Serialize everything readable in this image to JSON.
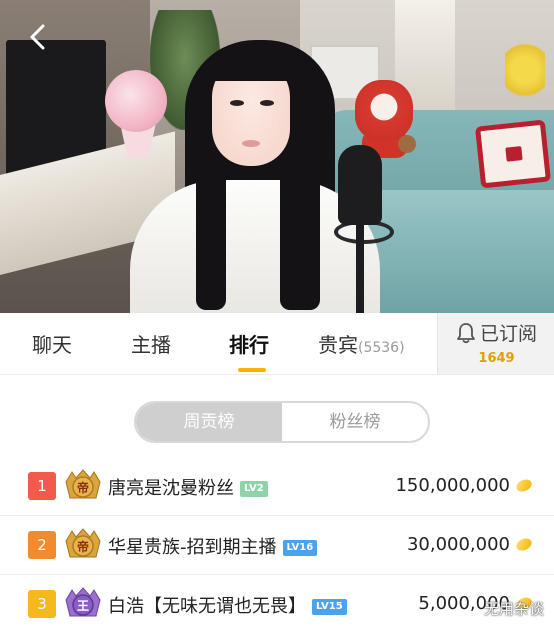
{
  "tabs": [
    {
      "label": "聊天",
      "active": false
    },
    {
      "label": "主播",
      "active": false
    },
    {
      "label": "排行",
      "active": true
    },
    {
      "label": "贵宾",
      "count": "(5536)",
      "active": false
    }
  ],
  "subscribe": {
    "label": "已订阅",
    "count": "1649",
    "icon": "bell-icon"
  },
  "board_toggle": {
    "options": [
      "周贡榜",
      "粉丝榜"
    ],
    "selected": "周贡榜"
  },
  "colors": {
    "accent": "#ffb000",
    "rank1": "#f25b4c",
    "rank2": "#f28a2e",
    "rank3": "#f5b81e",
    "lv_green": "#8fd3a8",
    "lv_blue": "#4aa3f0"
  },
  "ranking": [
    {
      "rank": "1",
      "name": "唐亮是沈曼粉丝",
      "level": "LV2",
      "score": "150,000,000",
      "medal": "帝"
    },
    {
      "rank": "2",
      "name": "华星贵族-招到期主播",
      "level": "LV16",
      "score": "30,000,000",
      "medal": "帝"
    },
    {
      "rank": "3",
      "name": "白浩【无味无谓也无畏】",
      "level": "LV15",
      "score": "5,000,000",
      "medal": "王"
    }
  ],
  "watermark": "无用杂谈"
}
